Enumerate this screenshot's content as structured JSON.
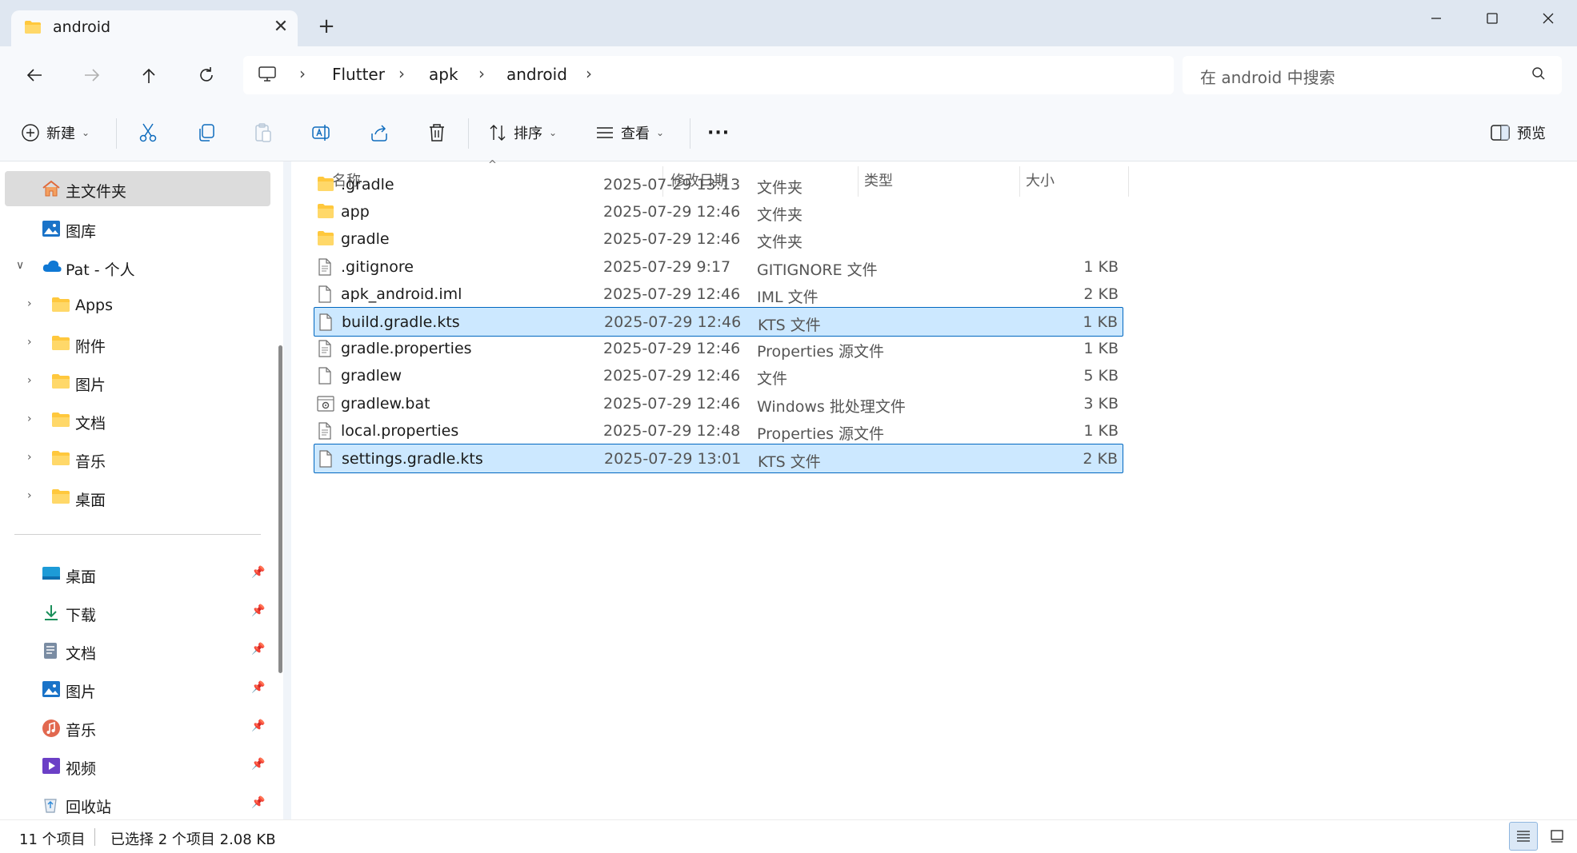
{
  "window": {
    "tab_title": "android"
  },
  "address": {
    "breadcrumbs": [
      "Flutter",
      "apk",
      "android"
    ],
    "search_placeholder": "在 android 中搜索"
  },
  "commandbar": {
    "new_label": "新建",
    "sort_label": "排序",
    "view_label": "查看",
    "more_label": "···",
    "preview_label": "预览"
  },
  "sidebar": {
    "home": "主文件夹",
    "gallery": "图库",
    "onedrive": "Pat - 个人",
    "onedrive_children": [
      "Apps",
      "附件",
      "图片",
      "文档",
      "音乐",
      "桌面"
    ],
    "quick_access": [
      {
        "label": "桌面",
        "icon": "desktop-icon"
      },
      {
        "label": "下载",
        "icon": "download-icon"
      },
      {
        "label": "文档",
        "icon": "document-icon"
      },
      {
        "label": "图片",
        "icon": "pictures-icon"
      },
      {
        "label": "音乐",
        "icon": "music-icon"
      },
      {
        "label": "视频",
        "icon": "video-icon"
      },
      {
        "label": "回收站",
        "icon": "recycle-bin-icon"
      }
    ]
  },
  "columns": {
    "name": "名称",
    "modified": "修改日期",
    "type": "类型",
    "size": "大小"
  },
  "files": [
    {
      "name": ".gradle",
      "date": "2025-07-29 13:13",
      "type": "文件夹",
      "size": "",
      "icon": "folder-icon",
      "selected": false
    },
    {
      "name": "app",
      "date": "2025-07-29 12:46",
      "type": "文件夹",
      "size": "",
      "icon": "folder-icon",
      "selected": false
    },
    {
      "name": "gradle",
      "date": "2025-07-29 12:46",
      "type": "文件夹",
      "size": "",
      "icon": "folder-icon",
      "selected": false
    },
    {
      "name": ".gitignore",
      "date": "2025-07-29 9:17",
      "type": "GITIGNORE 文件",
      "size": "1 KB",
      "icon": "text-file-icon",
      "selected": false
    },
    {
      "name": "apk_android.iml",
      "date": "2025-07-29 12:46",
      "type": "IML 文件",
      "size": "2 KB",
      "icon": "file-icon",
      "selected": false
    },
    {
      "name": "build.gradle.kts",
      "date": "2025-07-29 12:46",
      "type": "KTS 文件",
      "size": "1 KB",
      "icon": "file-icon",
      "selected": true
    },
    {
      "name": "gradle.properties",
      "date": "2025-07-29 12:46",
      "type": "Properties 源文件",
      "size": "1 KB",
      "icon": "text-file-icon",
      "selected": false
    },
    {
      "name": "gradlew",
      "date": "2025-07-29 12:46",
      "type": "文件",
      "size": "5 KB",
      "icon": "file-icon",
      "selected": false
    },
    {
      "name": "gradlew.bat",
      "date": "2025-07-29 12:46",
      "type": "Windows 批处理文件",
      "size": "3 KB",
      "icon": "batch-file-icon",
      "selected": false
    },
    {
      "name": "local.properties",
      "date": "2025-07-29 12:48",
      "type": "Properties 源文件",
      "size": "1 KB",
      "icon": "text-file-icon",
      "selected": false
    },
    {
      "name": "settings.gradle.kts",
      "date": "2025-07-29 13:01",
      "type": "KTS 文件",
      "size": "2 KB",
      "icon": "file-icon",
      "selected": true
    }
  ],
  "status": {
    "item_count": "11 个项目",
    "selection": "已选择 2 个项目  2.08 KB"
  },
  "colors": {
    "selection_fill": "#cce8ff",
    "selection_border": "#0067c0",
    "folder": "#ffc83d"
  }
}
